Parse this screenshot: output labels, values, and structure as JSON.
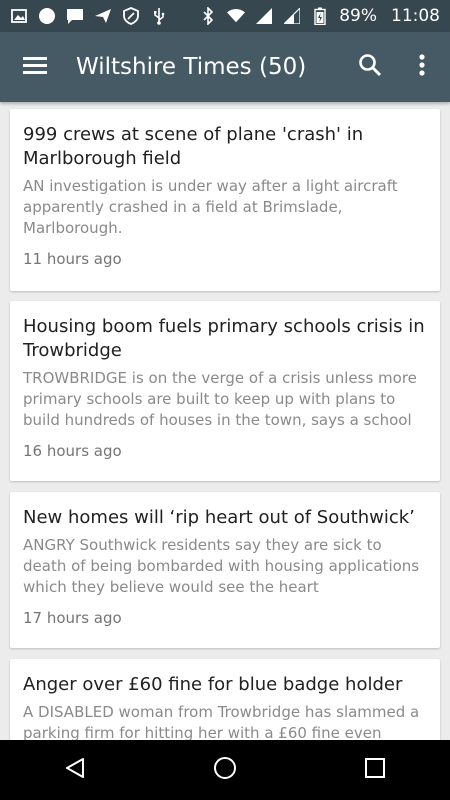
{
  "status_bar": {
    "battery": "89%",
    "time": "11:08"
  },
  "toolbar": {
    "title": "Wiltshire Times (50)"
  },
  "articles": [
    {
      "title": "999 crews at scene of plane 'crash' in Marlborough field",
      "summary": "AN investigation is under way after a light aircraft apparently crashed in a field at Brimslade, Marlborough.",
      "time": "11 hours ago"
    },
    {
      "title": "Housing boom fuels primary schools crisis in Trowbridge",
      "summary": "TROWBRIDGE is on the verge of a crisis unless more primary schools are built to keep up with plans to build hundreds of houses in the town, says a school",
      "time": "16 hours ago"
    },
    {
      "title": "New homes will ‘rip heart out of Southwick’",
      "summary": "ANGRY Southwick residents say they are sick to death of being bombarded with housing applications which they believe would see the heart",
      "time": "17 hours ago"
    },
    {
      "title": "Anger over £60 fine for blue badge holder",
      "summary": "A DISABLED woman from Trowbridge has slammed a parking firm for hitting her with a £60 fine even",
      "time": ""
    }
  ],
  "colors": {
    "status_bar": "#37474f",
    "toolbar": "#455a64",
    "background": "#ececec"
  }
}
